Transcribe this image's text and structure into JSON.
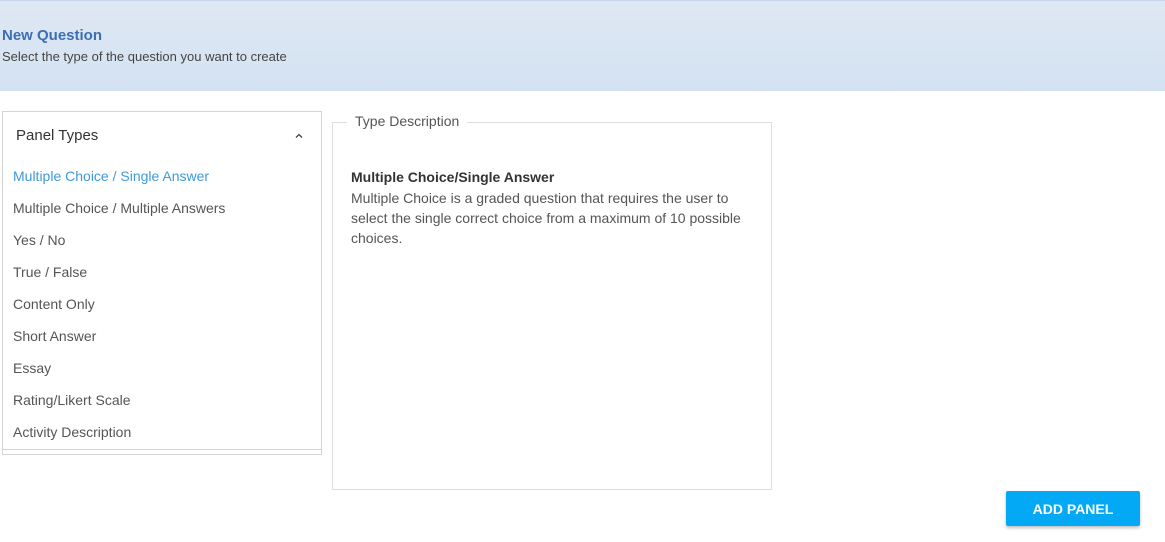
{
  "header": {
    "title": "New Question",
    "subtitle": "Select the type of the question you want to create"
  },
  "panel_types": {
    "title": "Panel Types",
    "toggle_icon": "chevron-up-icon",
    "items": [
      {
        "label": "Multiple Choice / Single Answer",
        "selected": true
      },
      {
        "label": "Multiple Choice / Multiple Answers",
        "selected": false
      },
      {
        "label": "Yes / No",
        "selected": false
      },
      {
        "label": "True / False",
        "selected": false
      },
      {
        "label": "Content Only",
        "selected": false
      },
      {
        "label": "Short Answer",
        "selected": false
      },
      {
        "label": "Essay",
        "selected": false
      },
      {
        "label": "Rating/Likert Scale",
        "selected": false
      },
      {
        "label": "Activity Description",
        "selected": false
      }
    ]
  },
  "type_description": {
    "legend": "Type Description",
    "heading": "Multiple Choice/Single Answer",
    "body": "Multiple Choice is a graded question that requires the user to select the single correct choice from a maximum of 10 possible choices."
  },
  "actions": {
    "add_panel_label": "ADD PANEL"
  },
  "colors": {
    "accent": "#03a9f4",
    "selected_item": "#3d9ad8",
    "header_title": "#3d6eb4"
  }
}
